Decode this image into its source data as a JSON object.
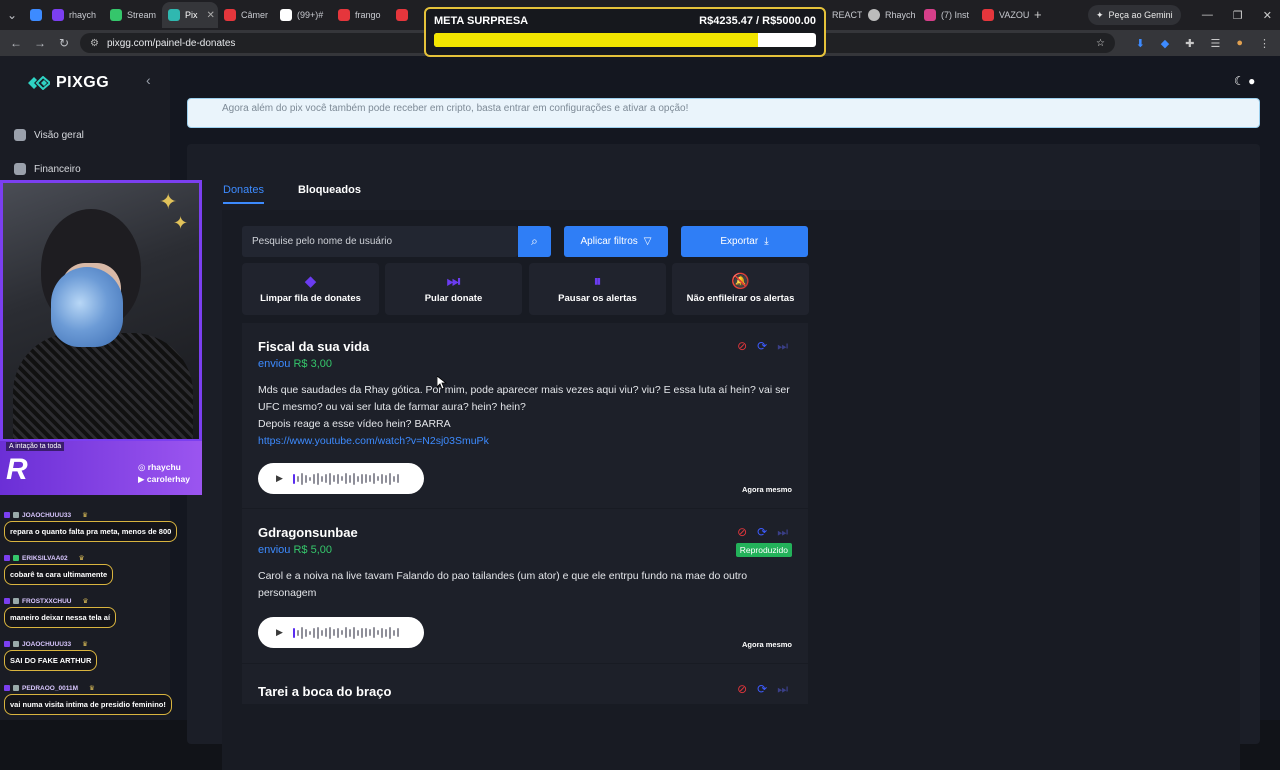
{
  "browser": {
    "tabs": [
      {
        "label": "",
        "color": "#3d8bff",
        "active": false
      },
      {
        "label": "rhaych",
        "color": "#7b3ff0",
        "active": false
      },
      {
        "label": "Stream",
        "color": "#35c66b",
        "active": false
      },
      {
        "label": "Pix",
        "color": "#2fb8b0",
        "active": true
      },
      {
        "label": "Câmer",
        "color": "#e5363c",
        "active": false
      },
      {
        "label": "(99+)#",
        "color": "#ffffff",
        "active": false
      },
      {
        "label": "frango",
        "color": "#e5363c",
        "active": false
      },
      {
        "label": "",
        "color": "#e5363c",
        "active": false
      }
    ],
    "tabs_right": [
      {
        "label": "REACT",
        "color": "#3d8bff"
      },
      {
        "label": "Rhaych",
        "color": "#bbbbbb"
      },
      {
        "label": "(7) Inst",
        "color": "#d63f8a"
      },
      {
        "label": "VAZOU",
        "color": "#e5363c"
      }
    ],
    "gemini_label": "Peça ao Gemini",
    "url": "pixgg.com/painel-de-donates"
  },
  "meta": {
    "title": "META SURPRESA",
    "progress_text": "R$4235.47 / R$5000.00",
    "progress_fraction": 0.847,
    "bar_color": "#f2e500"
  },
  "sidebar": {
    "logo": "PIXGG",
    "items": [
      {
        "label": "Visão geral"
      },
      {
        "label": "Financeiro"
      }
    ]
  },
  "main": {
    "banner": "Agora além do pix você também pode receber em cripto, basta entrar em configurações e ativar a opção!",
    "tabs": [
      {
        "label": "Donates"
      },
      {
        "label": "Bloqueados"
      }
    ],
    "search_placeholder": "Pesquise pelo nome de usuário",
    "apply_filters": "Aplicar filtros",
    "export": "Exportar",
    "actions": [
      {
        "label": "Limpar fila de donates",
        "icon": "eraser-icon"
      },
      {
        "label": "Pular donate",
        "icon": "skip-icon"
      },
      {
        "label": "Pausar os alertas",
        "icon": "pause-icon"
      },
      {
        "label": "Não enfileirar os alertas",
        "icon": "bell-off-icon"
      }
    ],
    "donates": [
      {
        "name": "Fiscal da sua vida",
        "sent_label": "enviou",
        "amount": "R$ 3,00",
        "message": "Mds que saudades da Rhay gótica. Por mim, pode aparecer mais vezes aqui viu? viu? E essa luta aí hein? vai ser UFC mesmo? ou vai ser luta de farmar aura? hein? hein?",
        "message2": "Depois reage a esse vídeo hein? BARRA",
        "link": "https://www.youtube.com/watch?v=N2sj03SmuPk",
        "time": "Agora mesmo"
      },
      {
        "name": "Gdragonsunbae",
        "sent_label": "enviou",
        "amount": "R$ 5,00",
        "badge": "Reproduzido",
        "message": "Carol e a noiva na live tavam Falando do pao tailandes (um ator) e que ele entrpu fundo na mae do outro personagem",
        "time": "Agora mesmo"
      },
      {
        "name": "Tarei a boca do braço"
      }
    ]
  },
  "stream": {
    "invite_text": "A intação ta toda",
    "socials": [
      "rhaychu",
      "carolerhay"
    ],
    "chat": [
      {
        "user": "JOAOCHUUU33",
        "text": "repara o quanto falta pra meta, menos de 800"
      },
      {
        "user": "ERIKSILVAA02",
        "text": "cobarê ta cara ultimamente"
      },
      {
        "user": "FROSTXXCHUU",
        "text": "maneiro deixar nessa tela aí"
      },
      {
        "user": "JOAOCHUUU33",
        "text": "SAI DO FAKE ARTHUR"
      },
      {
        "user": "PEDRAOO_0011M",
        "text": "vai numa visita intima de presidio feminino!"
      }
    ]
  }
}
